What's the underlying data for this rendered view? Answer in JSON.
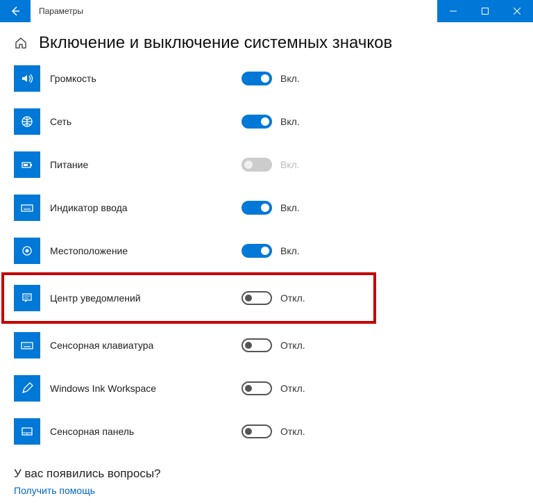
{
  "window": {
    "title": "Параметры"
  },
  "page": {
    "title": "Включение и выключение системных значков"
  },
  "labels": {
    "on": "Вкл.",
    "off": "Откл."
  },
  "items": [
    {
      "id": "volume",
      "label": "Громкость",
      "state": "on",
      "icon": "volume"
    },
    {
      "id": "network",
      "label": "Сеть",
      "state": "on",
      "icon": "globe"
    },
    {
      "id": "power",
      "label": "Питание",
      "state": "disabled",
      "stateLabel": "Вкл.",
      "icon": "battery"
    },
    {
      "id": "input",
      "label": "Индикатор ввода",
      "state": "on",
      "icon": "keyboard"
    },
    {
      "id": "location",
      "label": "Местоположение",
      "state": "on",
      "icon": "location"
    },
    {
      "id": "action",
      "label": "Центр уведомлений",
      "state": "off",
      "icon": "action",
      "highlight": true
    },
    {
      "id": "touchkb",
      "label": "Сенсорная клавиатура",
      "state": "off",
      "icon": "keyboard"
    },
    {
      "id": "ink",
      "label": "Windows Ink Workspace",
      "state": "off",
      "icon": "pen"
    },
    {
      "id": "touchpad",
      "label": "Сенсорная панель",
      "state": "off",
      "icon": "touchpad"
    }
  ],
  "footer": {
    "question": "У вас появились вопросы?",
    "help_link": "Получить помощь"
  }
}
